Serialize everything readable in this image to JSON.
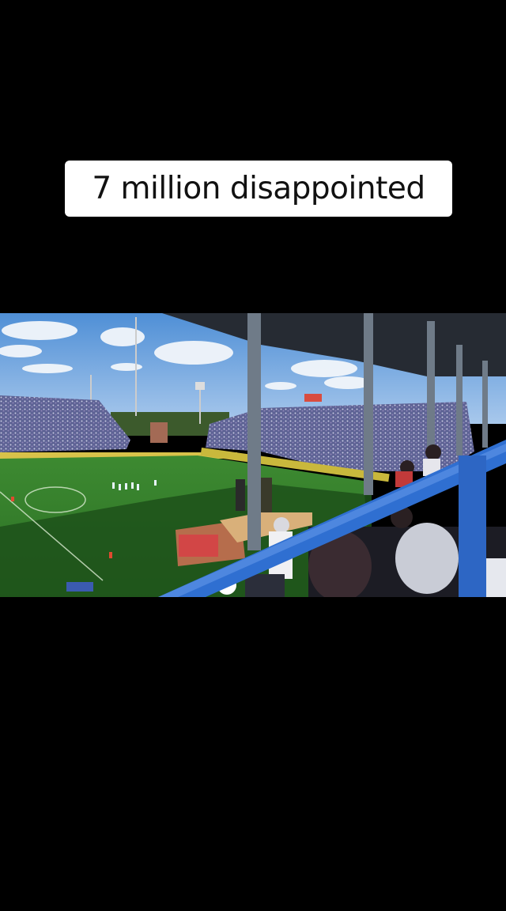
{
  "caption": {
    "text": "7 million disappointed"
  },
  "video": {
    "description_icon": "stadium-photo",
    "colors": {
      "sky": "#6aa2dd",
      "pitch": "#2f7a28",
      "shadow_pitch": "#1b4b17",
      "crowd": "#6b6f9e",
      "railing": "#2f6fd1",
      "roof": "#2a3038"
    }
  }
}
